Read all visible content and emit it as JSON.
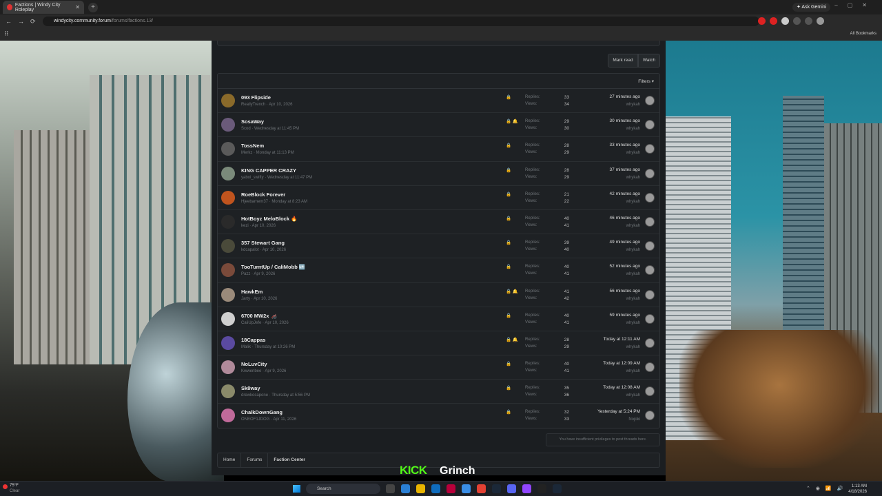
{
  "browser": {
    "tab_title": "Factions | Windy City Roleplay",
    "tab_close": "✕",
    "new_tab": "+",
    "ask_gemini": "✦ Ask Gemini",
    "url_host": "windycity.community.forum",
    "url_path": "/forums/factions.13/",
    "all_bookmarks": "All Bookmarks",
    "back": "←",
    "forward": "→",
    "reload": "⟳"
  },
  "forum": {
    "mark_read": "Mark read",
    "watch": "Watch",
    "filters": "Filters ▾",
    "replies_label": "Replies:",
    "views_label": "Views:",
    "no_post_notice": "You have insufficient privileges to post threads here.",
    "breadcrumbs": [
      "Home",
      "Forums",
      "Faction Center"
    ],
    "threads": [
      {
        "title": "093 Flipside",
        "meta": "ReallyTrench · Apr 10, 2026",
        "replies": "33",
        "views": "34",
        "last": "27 minutes ago",
        "user": "whykah",
        "status": "🔒",
        "avatar": "#8a6a2a"
      },
      {
        "title": "SosaWay",
        "meta": "Scod · Wednesday at 11:45 PM",
        "replies": "29",
        "views": "30",
        "last": "30 minutes ago",
        "user": "whykah",
        "status": "🔒 🔔",
        "avatar": "#6a5a7a"
      },
      {
        "title": "TossNem",
        "meta": "Merkz · Monday at 11:13 PM",
        "replies": "28",
        "views": "29",
        "last": "33 minutes ago",
        "user": "whykah",
        "status": "🔒",
        "avatar": "#5a5a5a"
      },
      {
        "title": "KING CAPPER CRAZY",
        "meta": "yaboi_swifty · Wednesday at 11:47 PM",
        "replies": "28",
        "views": "29",
        "last": "37 minutes ago",
        "user": "whykah",
        "status": "🔒",
        "avatar": "#7a8a7a"
      },
      {
        "title": "RoeBlock Forever",
        "meta": "Hjeebamem37 · Monday at 8:23 AM",
        "replies": "21",
        "views": "22",
        "last": "42 minutes ago",
        "user": "whykah",
        "status": "🔒",
        "avatar": "#c0541e"
      },
      {
        "title": "HotBoyz MeloBlock 🔥",
        "meta": "kezi · Apr 10, 2026",
        "replies": "40",
        "views": "41",
        "last": "46 minutes ago",
        "user": "whykah",
        "status": "🔒",
        "avatar": "#2a2a2a"
      },
      {
        "title": "357 Stewart Gang",
        "meta": "kdcapalot · Apr 10, 2026",
        "replies": "39",
        "views": "40",
        "last": "49 minutes ago",
        "user": "whykah",
        "status": "🔒",
        "avatar": "#4a4a3a"
      },
      {
        "title": "TooTurntUp / CaliMobb 🆙",
        "meta": "Pazz · Apr 9, 2026",
        "replies": "40",
        "views": "41",
        "last": "52 minutes ago",
        "user": "whykah",
        "status": "🔒",
        "avatar": "#7a4a3a"
      },
      {
        "title": "HawkEm",
        "meta": "Jarty · Apr 10, 2026",
        "replies": "41",
        "views": "42",
        "last": "56 minutes ago",
        "user": "whykah",
        "status": "🔒 🔔",
        "avatar": "#9a8a7a"
      },
      {
        "title": "6700 MW2x 🦽",
        "meta": "CaliUpJefe · Apr 10, 2026",
        "replies": "40",
        "views": "41",
        "last": "59 minutes ago",
        "user": "whykah",
        "status": "🔒",
        "avatar": "#cfcfcf"
      },
      {
        "title": "18Cappas",
        "meta": "Malik · Thursday at 10:26 PM",
        "replies": "28",
        "views": "29",
        "last": "Today at 12:11 AM",
        "user": "whykah",
        "status": "🔒 🔔",
        "avatar": "#5a4aa0"
      },
      {
        "title": "NoLuvCity",
        "meta": "Kwwenbee · Apr 9, 2026",
        "replies": "40",
        "views": "41",
        "last": "Today at 12:09 AM",
        "user": "whykah",
        "status": "🔒",
        "avatar": "#b08a9a"
      },
      {
        "title": "Sk8way",
        "meta": "drewkocapone · Thursday at 5:56 PM",
        "replies": "35",
        "views": "36",
        "last": "Today at 12:08 AM",
        "user": "whykah",
        "status": "🔒",
        "avatar": "#8a8a6a"
      },
      {
        "title": "ChalkDownGang",
        "meta": "ONEOF1JDOG · Apr 11, 2026",
        "replies": "32",
        "views": "33",
        "last": "Yesterday at 5:24 PM",
        "user": "Nojoki",
        "status": "🔒",
        "avatar": "#c06a9a"
      }
    ]
  },
  "overlay": {
    "kick": "KICK",
    "grinch": "Grinch"
  },
  "taskbar": {
    "temp": "75°F",
    "weather": "Clear",
    "search": "Search",
    "time": "1:13 AM",
    "date": "4/18/2026"
  }
}
